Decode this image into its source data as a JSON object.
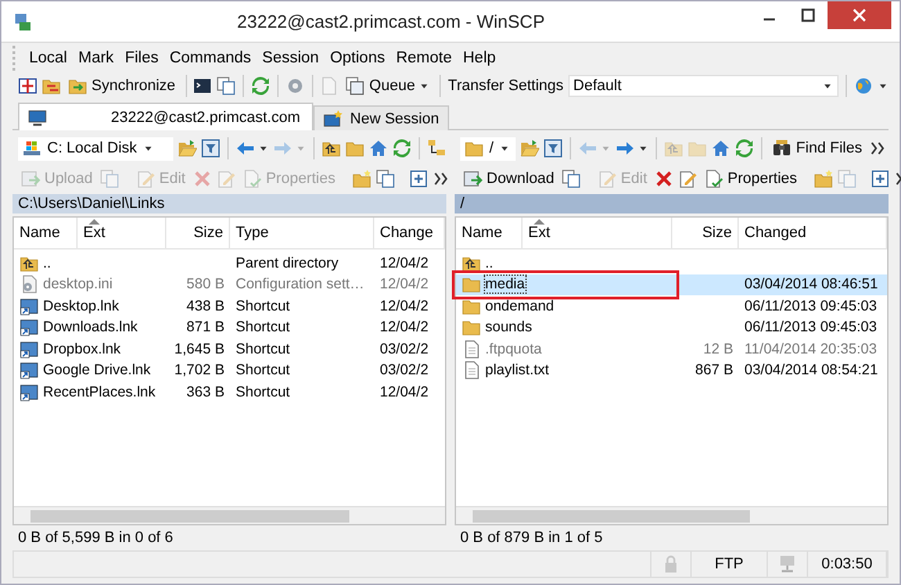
{
  "window": {
    "title": "23222@cast2.primcast.com - WinSCP"
  },
  "menu": [
    "Local",
    "Mark",
    "Files",
    "Commands",
    "Session",
    "Options",
    "Remote",
    "Help"
  ],
  "toolbar": {
    "synchronize": "Synchronize",
    "queue": "Queue",
    "transfer_settings_label": "Transfer Settings",
    "transfer_settings_value": "Default"
  },
  "session_tabs": [
    {
      "label": "23222@cast2.primcast.com",
      "kind": "session",
      "selected": true
    },
    {
      "label": "New Session",
      "kind": "new",
      "selected": false
    }
  ],
  "panes": [
    {
      "location": "C: Local Disk",
      "kind": "local",
      "active": false,
      "back_enabled": true,
      "forward_enabled": false,
      "up_enabled": true,
      "actions": [
        {
          "label": "Upload",
          "disabled": true
        },
        {
          "label": "Edit",
          "disabled": true
        },
        {
          "label": "Properties",
          "disabled": true
        }
      ],
      "path": "C:\\Users\\Daniel\\Links",
      "columns": [
        {
          "label": "Name",
          "kind": "name",
          "sorted": false
        },
        {
          "label": "Ext",
          "kind": "ext",
          "sorted": true
        },
        {
          "label": "Size",
          "kind": "size",
          "sorted": false
        },
        {
          "label": "Type",
          "kind": "type",
          "sorted": false
        },
        {
          "label": "Change",
          "kind": "changed",
          "sorted": false
        }
      ],
      "rows": [
        {
          "name": "..",
          "kind": "parent",
          "size": "",
          "type": "Parent directory",
          "changed": "12/04/2",
          "dimmed": false,
          "selected": false,
          "highlighted": false
        },
        {
          "name": "desktop.ini",
          "kind": "settings",
          "size": "580 B",
          "type": "Configuration sett…",
          "changed": "12/04/2",
          "dimmed": true,
          "selected": false,
          "highlighted": false
        },
        {
          "name": "Desktop.lnk",
          "kind": "shortcut",
          "size": "438 B",
          "type": "Shortcut",
          "changed": "12/04/2",
          "dimmed": false,
          "selected": false,
          "highlighted": false
        },
        {
          "name": "Downloads.lnk",
          "kind": "shortcut",
          "size": "871 B",
          "type": "Shortcut",
          "changed": "12/04/2",
          "dimmed": false,
          "selected": false,
          "highlighted": false
        },
        {
          "name": "Dropbox.lnk",
          "kind": "shortcut",
          "size": "1,645 B",
          "type": "Shortcut",
          "changed": "03/02/2",
          "dimmed": false,
          "selected": false,
          "highlighted": false
        },
        {
          "name": "Google Drive.lnk",
          "kind": "shortcut",
          "size": "1,702 B",
          "type": "Shortcut",
          "changed": "03/02/2",
          "dimmed": false,
          "selected": false,
          "highlighted": false
        },
        {
          "name": "RecentPlaces.lnk",
          "kind": "shortcut",
          "size": "363 B",
          "type": "Shortcut",
          "changed": "12/04/2",
          "dimmed": false,
          "selected": false,
          "highlighted": false
        }
      ],
      "status": "0 B of 5,599 B in 0 of 6"
    },
    {
      "location": "/",
      "kind": "remote",
      "active": true,
      "back_enabled": false,
      "forward_enabled": true,
      "up_enabled": false,
      "find": "Find Files",
      "actions": [
        {
          "label": "Download",
          "disabled": false
        },
        {
          "label": "Edit",
          "disabled": true
        },
        {
          "label": "Properties",
          "disabled": false
        }
      ],
      "path": "/",
      "columns": [
        {
          "label": "Name",
          "kind": "name",
          "sorted": false
        },
        {
          "label": "Ext",
          "kind": "ext",
          "sorted": true
        },
        {
          "label": "Size",
          "kind": "size",
          "sorted": false
        },
        {
          "label": "Changed",
          "kind": "changed",
          "sorted": false
        }
      ],
      "rows": [
        {
          "name": "..",
          "kind": "parent",
          "size": "",
          "changed": "",
          "dimmed": false,
          "selected": false,
          "highlighted": false
        },
        {
          "name": "media",
          "kind": "folder",
          "size": "",
          "changed": "03/04/2014 08:46:51",
          "dimmed": false,
          "selected": true,
          "highlighted": true
        },
        {
          "name": "ondemand",
          "kind": "folder",
          "size": "",
          "changed": "06/11/2013 09:45:03",
          "dimmed": false,
          "selected": false,
          "highlighted": false
        },
        {
          "name": "sounds",
          "kind": "folder",
          "size": "",
          "changed": "06/11/2013 09:45:03",
          "dimmed": false,
          "selected": false,
          "highlighted": false
        },
        {
          "name": ".ftpquota",
          "kind": "file",
          "size": "12 B",
          "changed": "11/04/2014 20:35:03",
          "dimmed": true,
          "selected": false,
          "highlighted": false
        },
        {
          "name": "playlist.txt",
          "kind": "file",
          "size": "867 B",
          "changed": "03/04/2014 08:54:21",
          "dimmed": false,
          "selected": false,
          "highlighted": false
        }
      ],
      "status": "0 B of 879 B in 1 of 5"
    }
  ],
  "status_bar": {
    "protocol": "FTP",
    "elapsed": "0:03:50"
  }
}
